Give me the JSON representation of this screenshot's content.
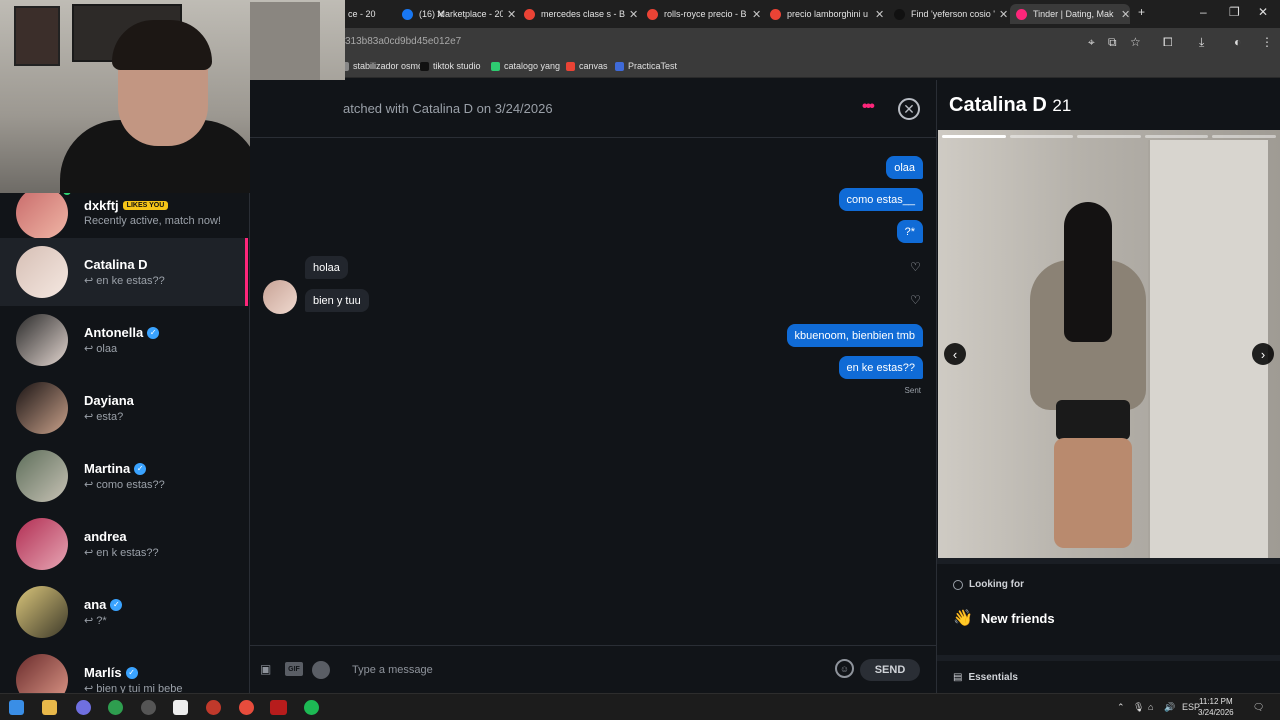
{
  "browser": {
    "tabs": [
      {
        "title": "ce - 20",
        "icon": "tab-icon",
        "color": "#4a4a4a"
      },
      {
        "title": "(16) Marketplace - 20",
        "icon": "facebook-icon",
        "color": "#1877f2"
      },
      {
        "title": "mercedes clase s - Bu",
        "icon": "google-icon",
        "color": "#ea4335"
      },
      {
        "title": "rolls-royce precio - B",
        "icon": "google-icon",
        "color": "#ea4335"
      },
      {
        "title": "precio lamborghini u",
        "icon": "google-icon",
        "color": "#ea4335"
      },
      {
        "title": "Find 'yeferson cosio '",
        "icon": "tiktok-icon",
        "color": "#111111"
      },
      {
        "title": "Tinder | Dating, Mak",
        "icon": "tinder-icon",
        "color": "#fd267a"
      }
    ],
    "new_tab": "+",
    "url": "313b83a0cd9bd45e012e7",
    "bookmarks": [
      {
        "label": "stabilizador osmo7",
        "color": "#888888"
      },
      {
        "label": "tiktok studio",
        "color": "#111111"
      },
      {
        "label": "catalogo yang",
        "color": "#2ecc71"
      },
      {
        "label": "canvas",
        "color": "#ea4335"
      },
      {
        "label": "PracticaTest",
        "color": "#3f6ad8"
      }
    ]
  },
  "matches": [
    {
      "name": "dxkftj",
      "badge": "LIKES YOU",
      "message": "Recently active, match now!",
      "verified": false
    },
    {
      "name": "Catalina D",
      "message": "↩ en ke estas??",
      "verified": false
    },
    {
      "name": "Antonella",
      "message": "↩ olaa",
      "verified": true
    },
    {
      "name": "Dayiana",
      "message": "↩ esta?",
      "verified": false
    },
    {
      "name": "Martina",
      "message": "↩ como estas??",
      "verified": true
    },
    {
      "name": "andrea",
      "message": "↩ en k estas??",
      "verified": false
    },
    {
      "name": "ana",
      "message": "↩ ?*",
      "verified": true
    },
    {
      "name": "Marlís",
      "message": "↩ bien y tui mi bebe",
      "verified": true
    }
  ],
  "chat": {
    "title": "atched with Catalina D on 3/24/2026",
    "messages": [
      {
        "dir": "out",
        "text": "olaa"
      },
      {
        "dir": "out",
        "text": "como estas__"
      },
      {
        "dir": "out",
        "text": "?*"
      },
      {
        "dir": "in",
        "text": "holaa"
      },
      {
        "dir": "in",
        "text": "bien y tuu"
      },
      {
        "dir": "out",
        "text": "kbuenoom, bienbien tmb"
      },
      {
        "dir": "out",
        "text": "en ke estas??"
      }
    ],
    "status": "Sent",
    "placeholder": "Type a message",
    "gif_label": "GIF",
    "send_label": "SEND"
  },
  "profile": {
    "name": "Catalina D",
    "age": "21",
    "looking_for_label": "Looking for",
    "looking_for_value": "New friends",
    "essentials_label": "Essentials",
    "photo_count": 5,
    "photo_index": 1
  },
  "taskbar": {
    "lang": "ESP",
    "time": "11:12 PM",
    "date": "3/24/2026"
  },
  "colors": {
    "tinder_pink": "#fd267a",
    "bubble_blue": "#106bd6",
    "verified_blue": "#3aa3ff"
  }
}
